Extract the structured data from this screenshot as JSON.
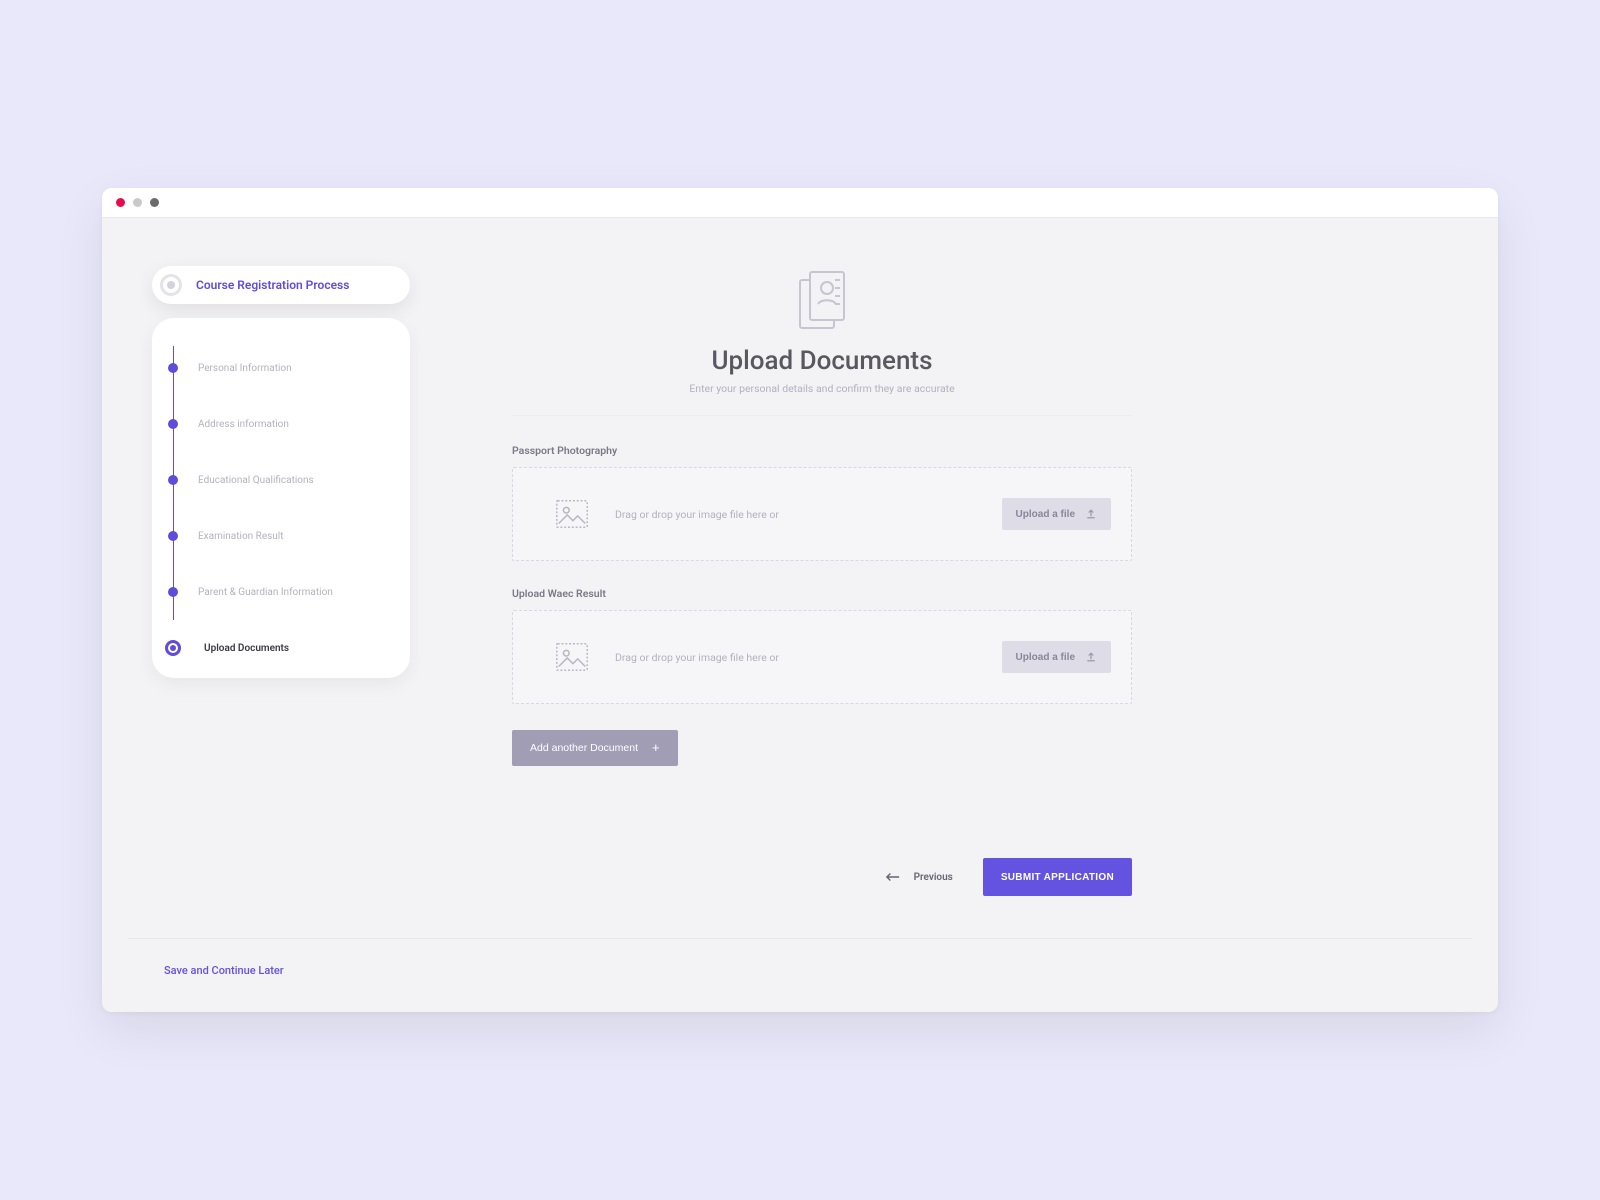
{
  "colors": {
    "accent": "#6353E0",
    "bg": "#E9E8FA"
  },
  "processPill": {
    "label": "Course Registration Process"
  },
  "steps": [
    {
      "label": "Personal Information",
      "active": false
    },
    {
      "label": "Address information",
      "active": false
    },
    {
      "label": "Educational Qualifications",
      "active": false
    },
    {
      "label": "Examination Result",
      "active": false
    },
    {
      "label": "Parent & Guardian Information",
      "active": false
    },
    {
      "label": "Upload Documents",
      "active": true
    }
  ],
  "page": {
    "title": "Upload Documents",
    "subtitle": "Enter your personal details and confirm they are accurate"
  },
  "uploads": [
    {
      "label": "Passport Photography",
      "hint": "Drag or drop your image file here or",
      "button": "Upload a file"
    },
    {
      "label": "Upload Waec Result",
      "hint": "Drag or drop your image file here or",
      "button": "Upload a file"
    }
  ],
  "addDoc": {
    "label": "Add another Document"
  },
  "nav": {
    "previous": "Previous",
    "submit": "SUBMIT APPLICATION"
  },
  "footer": {
    "saveLater": "Save and Continue Later"
  }
}
